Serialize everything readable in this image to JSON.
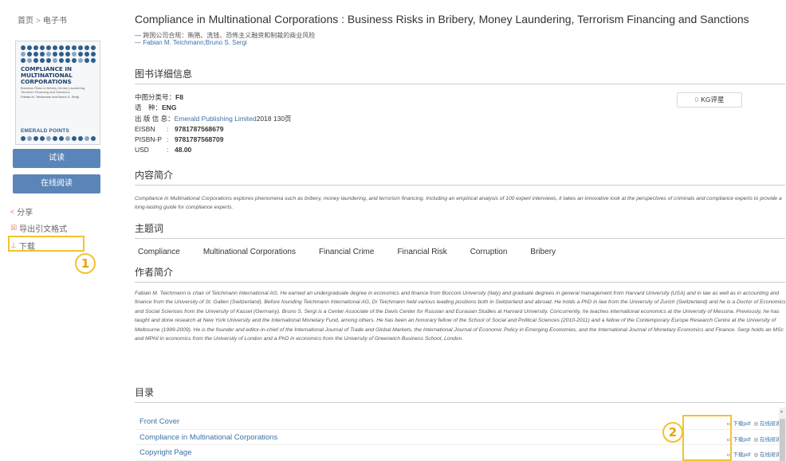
{
  "breadcrumb": {
    "home": "首页",
    "sep": ">",
    "current": "电子书"
  },
  "cover": {
    "title": "COMPLIANCE IN MULTINATIONAL CORPORATIONS",
    "subtitle": "Business Risks in Bribery, Money Laundering, Terrorism Financing and Sanctions",
    "authors": "Fabian M. Teichmann and Bruno S. Sergi",
    "publisher": "EMERALD POINTS"
  },
  "buttons": {
    "try": "试读",
    "online": "在线阅读"
  },
  "side_links": {
    "share": "分享",
    "export": "导出引文格式",
    "download": "下载"
  },
  "annotations": {
    "one": "1",
    "two": "2"
  },
  "book": {
    "title": "Compliance in Multinational Corporations : Business Risks in Bribery, Money Laundering, Terrorism Financing and Sanctions",
    "cn_subtitle": "— 跨国公司合规：贿赂、洗钱、恐怖主义融资和制裁的商业风险",
    "authors": "— Fabian M. Teichmann;Bruno S. Sergi"
  },
  "sections": {
    "detail": "图书详细信息",
    "intro": "内容简介",
    "keywords": "主题词",
    "author": "作者简介",
    "toc": "目录"
  },
  "meta": {
    "clc_label": "中图分类号：",
    "clc": "F8",
    "lang_label": "语　种：",
    "lang": "ENG",
    "pub_label": "出 版 信 息：",
    "publisher": "Emerald Publishing Limited",
    "pub_rest": " 2018 130页",
    "eisbn_label": "EISBN",
    "eisbn": "9781787568679",
    "pisbn_label": "PISBN-P",
    "pisbn": "9781787568709",
    "usd_label": "USD",
    "usd": "48.00",
    "colon": ":"
  },
  "kg": {
    "count": "0",
    "label": "KG评星"
  },
  "intro_text": "Compliance in Multinational Corporations explores phenomena such as bribery, money laundering, and terrorism financing. Including an empirical analysis of 100 expert interviews, it takes an innovative look at the perspectives of criminals and compliance experts to provide a long-lasting guide for compliance experts.",
  "keywords": [
    "Compliance",
    "Multinational Corporations",
    "Financial Crime",
    "Financial Risk",
    "Corruption",
    "Bribery"
  ],
  "author_text": "Fabian M. Teichmann is chair of Teichmann International AG. He earned an undergraduate degree in economics and finance from Bocconi University (Italy) and graduate degrees in general management from Harvard University (USA) and in law as well as in accounting and finance from the University of St. Gallen (Switzerland). Before founding Teichmann International AG, Dr Teichmann held various leading positions both in Switzerland and abroad. He holds a PhD in law from the University of Zurich (Switzerland) and he is a Doctor of Economics and Social Sciences from the University of Kassel (Germany). Bruno S. Sergi is a Center Associate of the Davis Center for Russian and Eurasian Studies at Harvard University. Concurrently, he teaches international economics at the University of Messina. Previously, he has taught and done research at New York University and the International Monetary Fund, among others. He has been an honorary fellow of the School of Social and Political Sciences (2010-2011) and a fellow of the Contemporary Europe Research Centre at the University of Melbourne (1999-2009). He is the founder and editor-in-chief of the International Journal of Trade and Global Markets, the International Journal of Economic Policy in Emerging Economies, and the International Journal of Monetary Economics and Finance. Sergi holds an MSc and MPhil in economics from the University of London and a PhD in economics from the University of Greenwich Business School, London.",
  "toc": {
    "download_label": "下载pdf",
    "read_label": "在线阅读",
    "items": [
      {
        "name": "Front Cover"
      },
      {
        "name": "Compliance in Multinational Corporations"
      },
      {
        "name": "Copyright Page"
      }
    ]
  }
}
